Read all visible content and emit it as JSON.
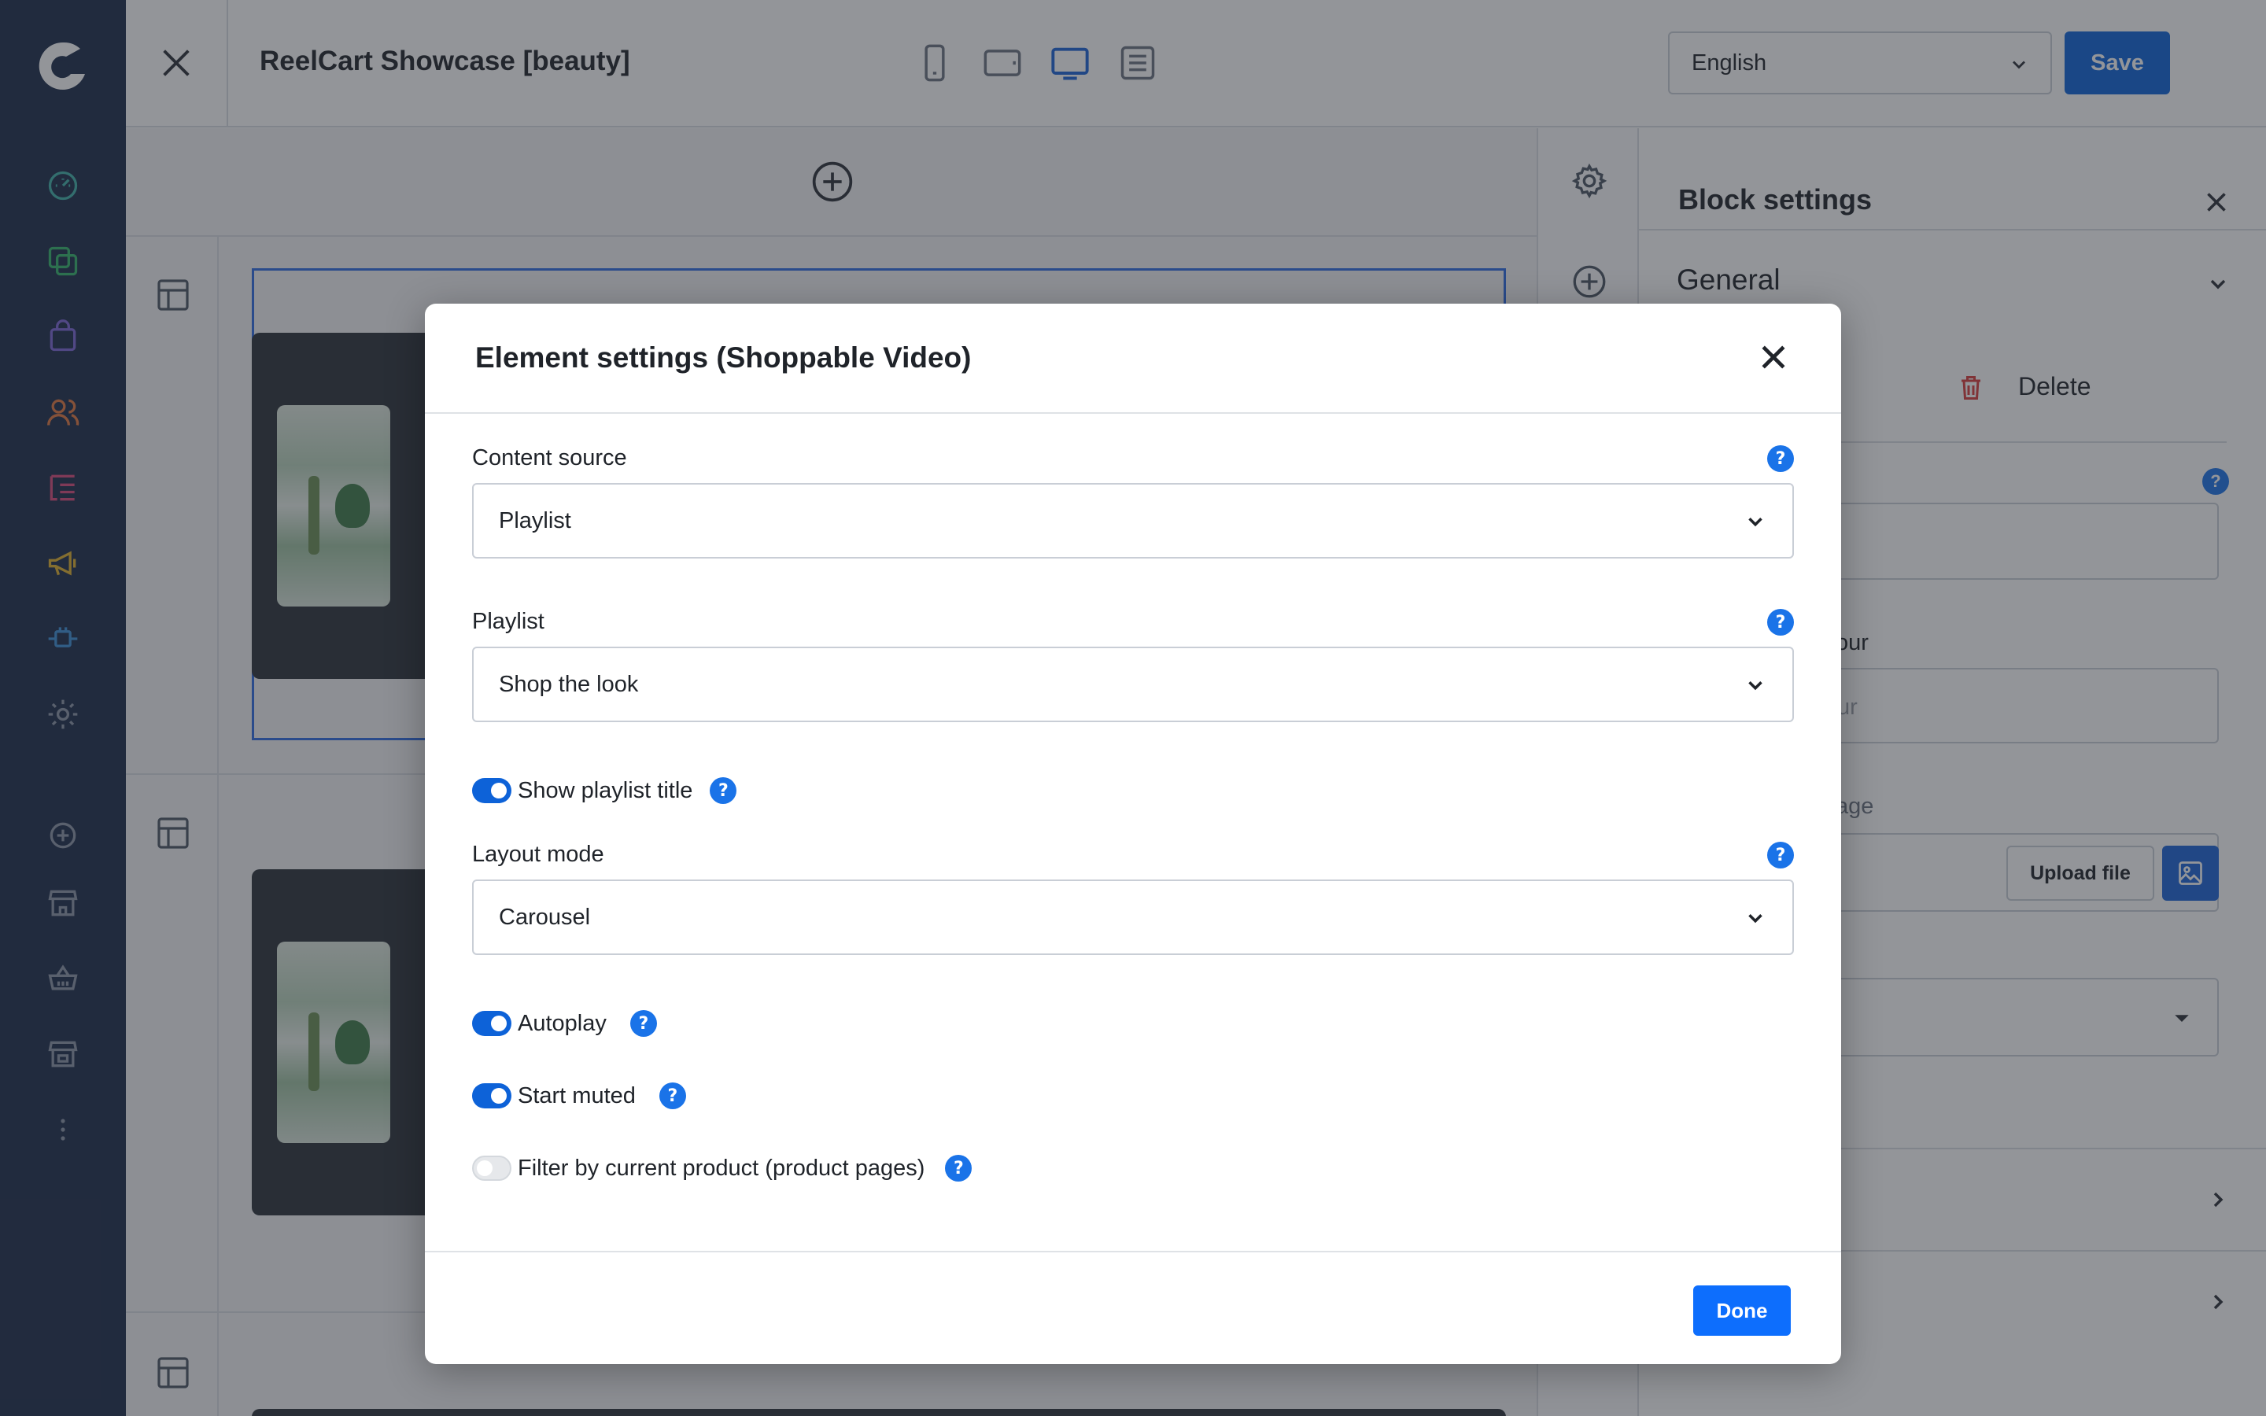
{
  "header": {
    "page_title": "ReelCart Showcase [beauty]",
    "language": "English",
    "save_label": "Save",
    "device_modes": [
      "mobile",
      "tablet",
      "desktop",
      "document"
    ],
    "active_device": "desktop"
  },
  "sidebar": {
    "items": [
      {
        "icon": "dashboard-icon",
        "color": "#3fb0a8"
      },
      {
        "icon": "pages-icon",
        "color": "#33b56b"
      },
      {
        "icon": "shopping-bag-icon",
        "color": "#7a64d6"
      },
      {
        "icon": "users-icon",
        "color": "#e0773f"
      },
      {
        "icon": "list-icon",
        "color": "#d6487a"
      },
      {
        "icon": "megaphone-icon",
        "color": "#e1b12c"
      },
      {
        "icon": "plugin-icon",
        "color": "#3b8fd6"
      },
      {
        "icon": "gear-icon",
        "color": "#8b95a6"
      },
      {
        "icon": "add-circle-icon",
        "color": "#8b95a6"
      },
      {
        "icon": "store-icon",
        "color": "#8b95a6"
      },
      {
        "icon": "basket-icon",
        "color": "#8b95a6"
      },
      {
        "icon": "storefront-icon",
        "color": "#8b95a6"
      },
      {
        "icon": "more-icon",
        "color": "#8b95a6"
      }
    ]
  },
  "panel": {
    "title": "Block settings",
    "general_label": "General",
    "duplicate_partial": "e",
    "delete_label": "Delete",
    "colour_partial": "our",
    "colour_placeholder_partial": "ur",
    "image_partial": "age",
    "upload_label": "Upload file"
  },
  "modal": {
    "title": "Element settings (Shoppable Video)",
    "content_source": {
      "label": "Content source",
      "value": "Playlist"
    },
    "playlist": {
      "label": "Playlist",
      "value": "Shop the look"
    },
    "show_playlist_title": {
      "label": "Show playlist title",
      "on": true
    },
    "layout_mode": {
      "label": "Layout mode",
      "value": "Carousel"
    },
    "autoplay": {
      "label": "Autoplay",
      "on": true
    },
    "start_muted": {
      "label": "Start muted",
      "on": true
    },
    "filter_by_product": {
      "label": "Filter by current product (product pages)",
      "on": false
    },
    "help_glyph": "?",
    "done_label": "Done"
  },
  "colors": {
    "accent": "#0d62d8",
    "sidebar_bg": "#1b2a49",
    "help_blue": "#1a73e8",
    "delete_red": "#d83a3a"
  }
}
